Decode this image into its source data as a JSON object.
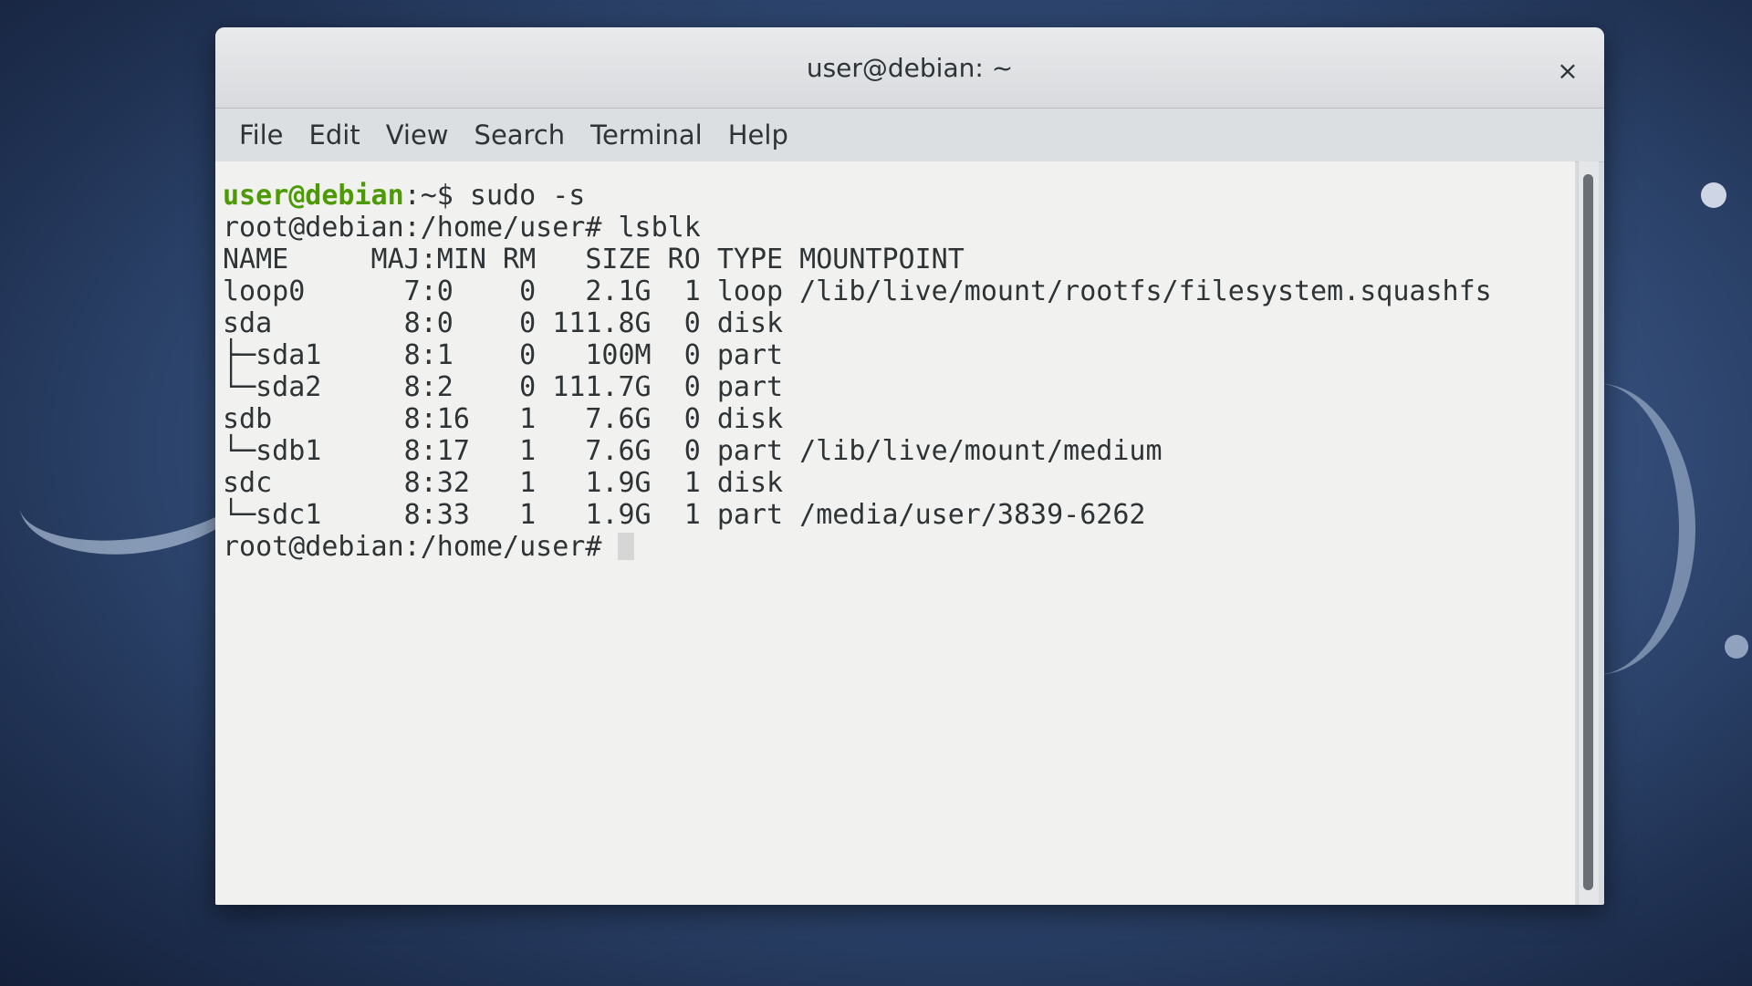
{
  "window": {
    "title": "user@debian: ~",
    "close_label": "×"
  },
  "menu": [
    "File",
    "Edit",
    "View",
    "Search",
    "Terminal",
    "Help"
  ],
  "terminal": {
    "line1_user": "user@debian",
    "line1_rest": ":~$ sudo -s",
    "lines": [
      "root@debian:/home/user# lsblk",
      "NAME     MAJ:MIN RM   SIZE RO TYPE MOUNTPOINT",
      "loop0      7:0    0   2.1G  1 loop /lib/live/mount/rootfs/filesystem.squashfs",
      "sda        8:0    0 111.8G  0 disk",
      "├─sda1     8:1    0   100M  0 part",
      "└─sda2     8:2    0 111.7G  0 part",
      "sdb        8:16   1   7.6G  0 disk",
      "└─sdb1     8:17   1   7.6G  0 part /lib/live/mount/medium",
      "sdc        8:32   1   1.9G  1 disk",
      "└─sdc1     8:33   1   1.9G  1 part /media/user/3839-6262"
    ],
    "current_prompt": "root@debian:/home/user# "
  },
  "colors": {
    "prompt_user": "#4e9a06",
    "terminal_bg": "#f1f1f0",
    "text": "#2e3436"
  }
}
